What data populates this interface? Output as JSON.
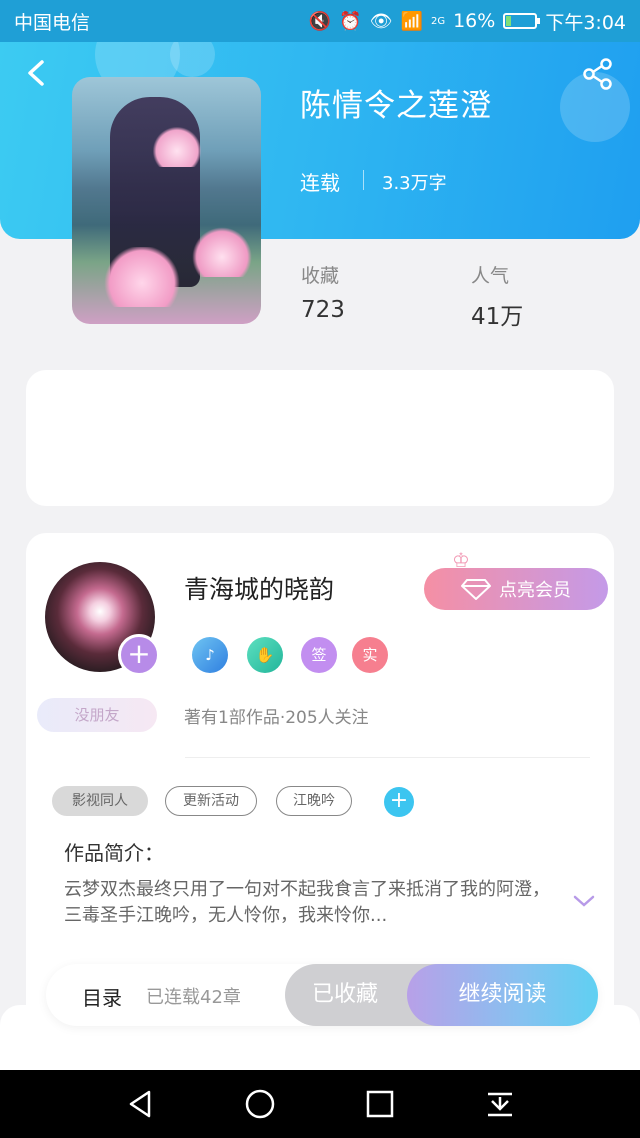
{
  "status_bar": {
    "carrier": "中国电信",
    "network": "2G",
    "battery": "16%",
    "battery_level": 0.16,
    "time": "下午3:04"
  },
  "book": {
    "title": "陈情令之莲澄",
    "status": "连载",
    "word_count": "3.3万字",
    "stats": [
      {
        "label": "收藏",
        "value": "723"
      },
      {
        "label": "人气",
        "value": "41万"
      }
    ]
  },
  "author": {
    "name": "青海城的晓韵",
    "vip_label": "点亮会员",
    "badges": [
      "签",
      "实"
    ],
    "no_friend_label": "没朋友",
    "meta": "著有1部作品·205人关注"
  },
  "tags": [
    "影视同人",
    "更新活动",
    "江晚吟"
  ],
  "intro": {
    "label": "作品简介：",
    "text": "云梦双杰最终只用了一句对不起我食言了来抵消了我的阿澄，三毒圣手江晚吟，无人怜你，我来怜你..."
  },
  "bottom": {
    "toc_label": "目录",
    "chapter_count": "已连载42章",
    "collected_label": "已收藏",
    "read_label": "继续阅读"
  },
  "icons": {
    "back": "back-arrow-icon",
    "share": "share-icon",
    "nav": [
      "nav-back-icon",
      "nav-home-icon",
      "nav-recents-icon",
      "nav-notification-icon"
    ]
  },
  "colors": {
    "header_blue": "#2fb6f1",
    "accent_purple": "#b78be8",
    "accent_cyan": "#3cc5f0"
  }
}
